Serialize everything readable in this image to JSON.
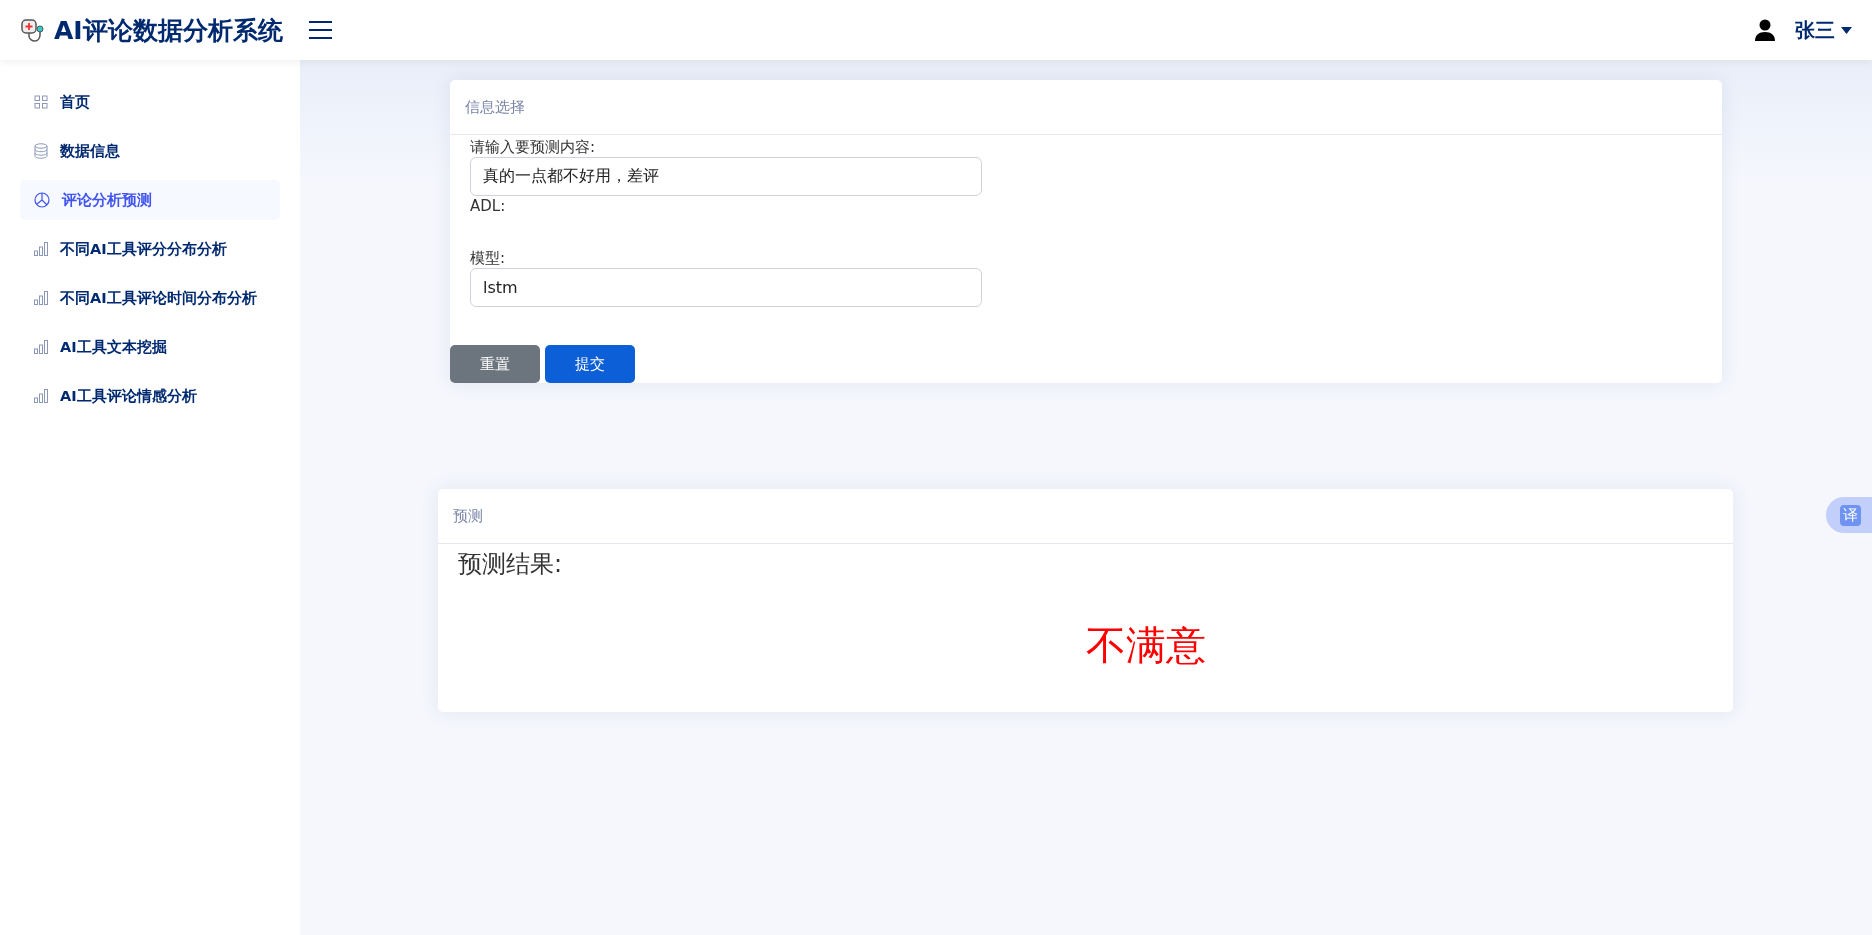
{
  "header": {
    "title": "AI评论数据分析系统",
    "user": "张三"
  },
  "sidebar": {
    "items": [
      {
        "label": "首页",
        "kind": "grid",
        "selected": false
      },
      {
        "label": "数据信息",
        "kind": "database",
        "selected": false
      },
      {
        "label": "评论分析预测",
        "kind": "pie",
        "selected": true
      },
      {
        "label": "不同AI工具评分分布分析",
        "kind": "bars",
        "selected": false
      },
      {
        "label": "不同AI工具评论时间分布分析",
        "kind": "bars",
        "selected": false
      },
      {
        "label": "AI工具文本挖掘",
        "kind": "bars",
        "selected": false
      },
      {
        "label": "AI工具评论情感分析",
        "kind": "bars",
        "selected": false
      }
    ]
  },
  "form_card": {
    "title": "信息选择",
    "fields": [
      {
        "label": "请输入要预测内容:",
        "kind": "input",
        "value": "真的一点都不好用，差评"
      },
      {
        "label": "ADL:",
        "kind": "text"
      },
      {
        "label": "模型:",
        "kind": "input",
        "value": "lstm"
      }
    ],
    "buttons": [
      {
        "label": "重置",
        "kind": "secondary"
      },
      {
        "label": "提交",
        "kind": "primary"
      }
    ]
  },
  "result_card": {
    "title": "预测",
    "heading": "预测结果:",
    "result": "不满意"
  },
  "floating_button": {
    "label": "译"
  }
}
